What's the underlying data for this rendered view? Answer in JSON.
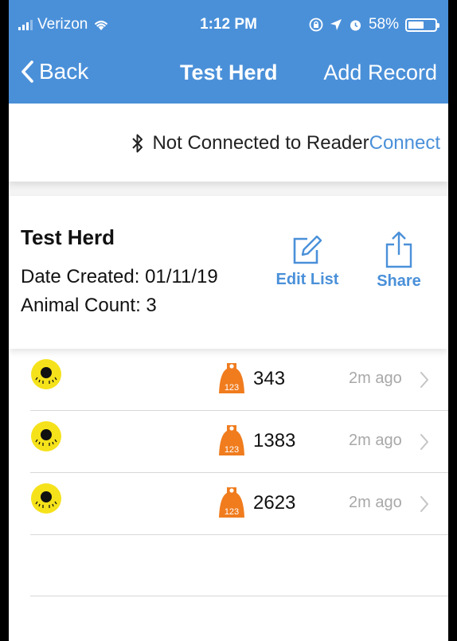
{
  "status_bar": {
    "carrier": "Verizon",
    "time": "1:12 PM",
    "battery_percent": "58%",
    "battery_level": 0.58
  },
  "nav": {
    "back_label": "Back",
    "title": "Test Herd",
    "add_label": "Add Record"
  },
  "connection": {
    "status_text": "Not Connected to Reader",
    "connect_label": "Connect"
  },
  "herd": {
    "name": "Test Herd",
    "date_created": "Date Created: 01/11/19",
    "animal_count": "Animal Count: 3",
    "edit_label": "Edit List",
    "share_label": "Share"
  },
  "records": [
    {
      "tag_number": "343",
      "time_ago": "2m ago",
      "tag_badge": "123"
    },
    {
      "tag_number": "1383",
      "time_ago": "2m ago",
      "tag_badge": "123"
    },
    {
      "tag_number": "2623",
      "time_ago": "2m ago",
      "tag_badge": "123"
    }
  ],
  "colors": {
    "accent": "#4a90d9",
    "eid_tag": "#f5e21b",
    "ear_tag": "#f07c1e"
  }
}
